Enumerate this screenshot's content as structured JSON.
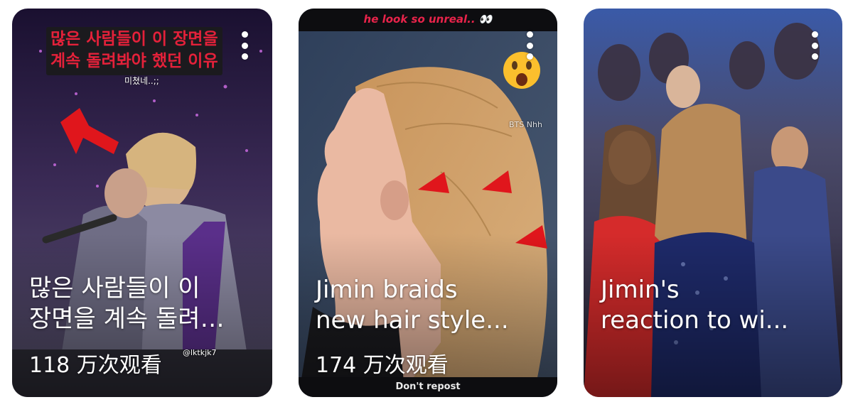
{
  "cards": [
    {
      "title": "많은 사람들이 이\n장면을 계속 돌려…",
      "views": "118 万次观看",
      "overlay_caption": "많은 사람들이 이 장면을\n계속 돌려봐야 했던 이유",
      "overlay_small": "미쳤네..;;",
      "watermark": "@lktkjk7",
      "more_icon": "vertical-ellipsis"
    },
    {
      "title": "Jimin braids\nnew hair style...",
      "views": "174 万次观看",
      "top_caption": "he look so unreal.. 👀",
      "bottom_caption": "Don't repost",
      "watermark": "BTS Nhh",
      "sticker": "shocked-face-emoji",
      "more_icon": "vertical-ellipsis"
    },
    {
      "title": "Jimin's\nreaction to wi...",
      "more_icon": "vertical-ellipsis"
    }
  ],
  "colors": {
    "arrow_red": "#e0161c",
    "caption_red": "#e4213a"
  }
}
